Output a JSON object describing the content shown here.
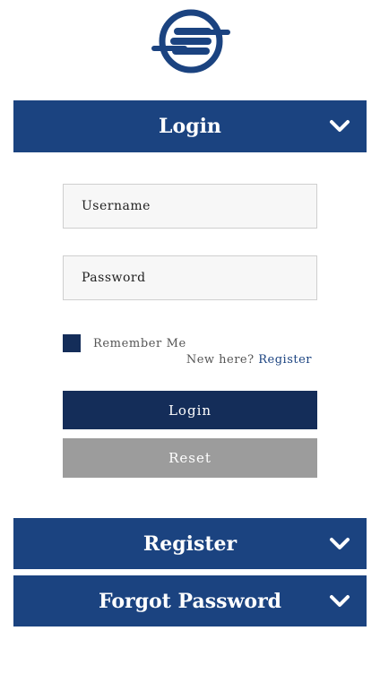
{
  "colors": {
    "header_bg": "#1b4380",
    "primary_button": "#142d59",
    "reset_button": "#9c9c9c",
    "link": "#1b4380"
  },
  "logo": {
    "icon": "brand-logo-icon"
  },
  "sections": {
    "login": {
      "title": "Login",
      "icon": "chevron-down-icon"
    },
    "register": {
      "title": "Register",
      "icon": "chevron-down-icon"
    },
    "forgot": {
      "title": "Forgot Password",
      "icon": "chevron-down-icon"
    }
  },
  "form": {
    "username_placeholder": "Username",
    "password_placeholder": "Password",
    "remember_label": "Remember Me",
    "new_here_text": "New here?",
    "register_link": "Register",
    "login_button": "Login",
    "reset_button": "Reset"
  }
}
